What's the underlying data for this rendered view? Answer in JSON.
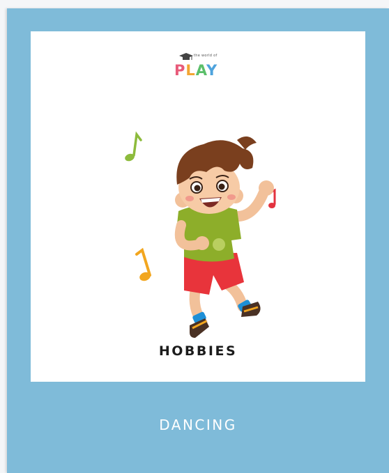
{
  "card": {
    "background": "#7fbbd9",
    "logo": {
      "small_text": "the world of",
      "word": "PLAY",
      "letter_colors": [
        "#e85b7a",
        "#f3a533",
        "#5bbf6a",
        "#4ea3dd"
      ]
    },
    "illustration": {
      "icon": "dancing-boy",
      "notes": [
        "music-note-icon",
        "music-note-icon",
        "music-note-icon"
      ]
    },
    "category": "HOBBIES",
    "word": "DANCING"
  }
}
